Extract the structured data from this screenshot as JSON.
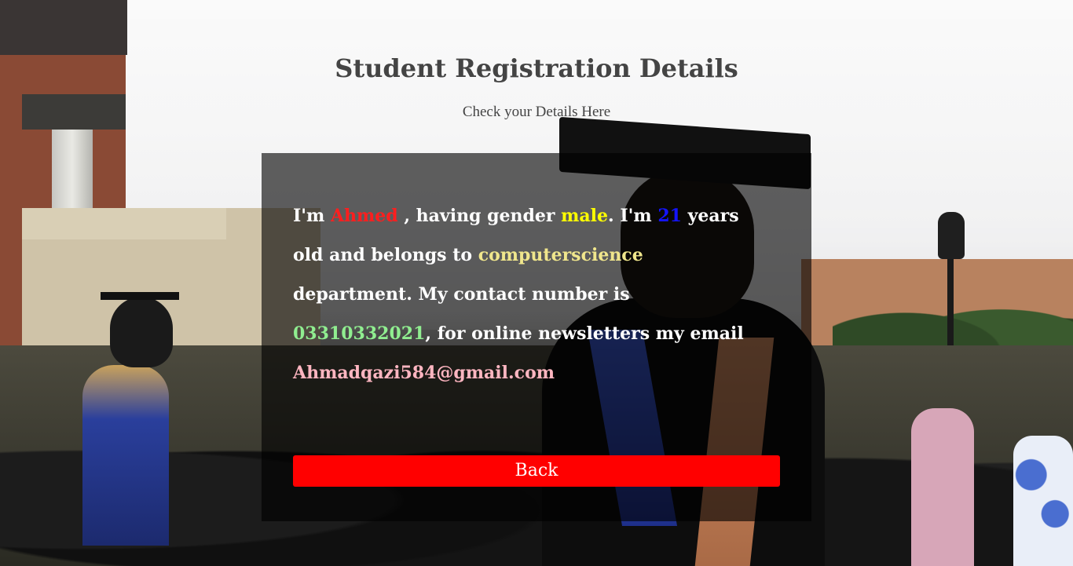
{
  "page": {
    "heading": "Student Registration Details",
    "subheading": "Check your Details Here"
  },
  "details": {
    "intro": "I'm ",
    "name": "Ahmed",
    "after_name": " , having gender ",
    "gender": "male",
    "after_gender": ". I'm ",
    "age": "21",
    "after_age": " years old and belongs to ",
    "department": "computerscience",
    "after_department": " department. My contact number is ",
    "phone": "03310332021",
    "after_phone": ", for online newsletters my email ",
    "email": "Ahmadqazi584@gmail.com"
  },
  "actions": {
    "back_label": "Back"
  },
  "colors": {
    "name": "#ff1e1e",
    "gender": "#ffff00",
    "age": "#1414ff",
    "department": "#f0e68c",
    "phone": "#90ee90",
    "email": "#ffb6c1",
    "back_button": "#ff0000",
    "panel": "rgba(0,0,0,0.62)"
  },
  "background": {
    "icon": "graduation-photo"
  }
}
